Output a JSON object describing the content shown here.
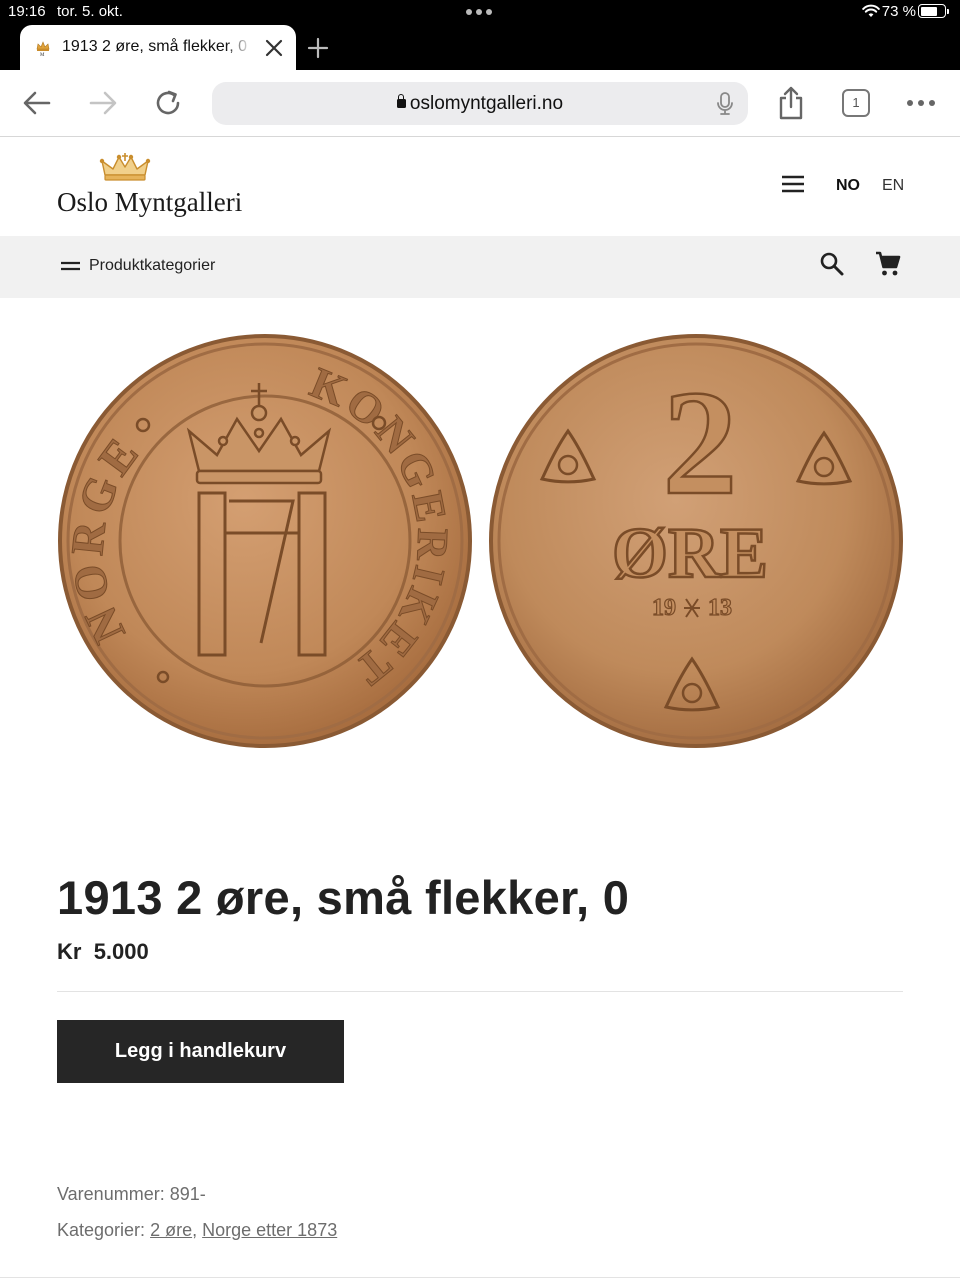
{
  "status_bar": {
    "time": "19:16",
    "date": "tor. 5. okt.",
    "battery": "73 %",
    "battery_level": 0.73
  },
  "browser": {
    "tab_title": "1913 2 øre, små flekker, 0",
    "url": "oslomyntgalleri.no",
    "tab_count": "1",
    "icons": [
      "back-arrow-icon",
      "forward-arrow-icon",
      "reload-icon",
      "lock-icon",
      "microphone-icon",
      "share-icon",
      "tabs-icon",
      "more-icon",
      "close-icon",
      "plus-icon"
    ]
  },
  "site": {
    "logo_part1": "Oslo ",
    "logo_part2": "Myntgalleri",
    "lang_no": "NO",
    "lang_en": "EN",
    "categories_label": "Produktkategorier"
  },
  "product": {
    "title": "1913 2 øre, små flekker, 0",
    "currency": "Kr",
    "price": "5.000",
    "add_to_cart": "Legg i handlekurv",
    "sku_label": "Varenummer:",
    "sku": "891-",
    "categories_label": "Kategorier:",
    "category_1": "2 øre",
    "category_sep": ",",
    "category_2": "Norge etter 1873",
    "obverse": {
      "legend_left": "NORGE",
      "legend_right": "KONGERIKET",
      "monogram": "H7"
    },
    "reverse": {
      "denomination": "2",
      "unit": "ØRE",
      "year_left": "19",
      "year_right": "13"
    }
  },
  "colors": {
    "coin_bronze": "#c08858",
    "coin_dark": "#8a5a34",
    "button_bg": "#262626",
    "catbar_bg": "#f1f1f1",
    "urlbar_bg": "#ececee"
  }
}
